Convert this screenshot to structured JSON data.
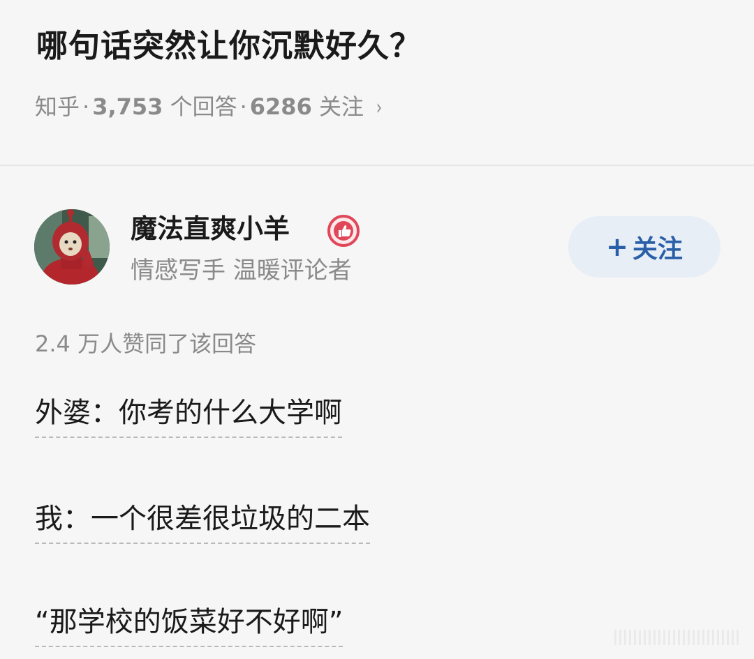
{
  "question": {
    "title": "哪句话突然让你沉默好久？",
    "source": "知乎",
    "answers_count": "3,753",
    "answers_label": "个回答",
    "followers_count": "6286",
    "followers_label": "关注",
    "chevron": "›"
  },
  "author": {
    "name": "魔法直爽小羊",
    "badge_icon": "thumbs-up-badge-icon",
    "bio": "情感写手 温暖评论者",
    "avatar_icon": "teletubby-avatar"
  },
  "follow_button": {
    "plus": "+",
    "label": "关注"
  },
  "answer": {
    "upvote_summary": "2.4 万人赞同了该回答",
    "lines": [
      "外婆：你考的什么大学啊",
      "我：一个很差很垃圾的二本",
      "“那学校的饭菜好不好啊”"
    ]
  },
  "colors": {
    "background": "#f6f6f6",
    "title": "#1a1a1a",
    "meta": "#8a8a8a",
    "follow_bg": "#e8eef6",
    "follow_text": "#2a5fa8",
    "badge": "#e0485a"
  }
}
